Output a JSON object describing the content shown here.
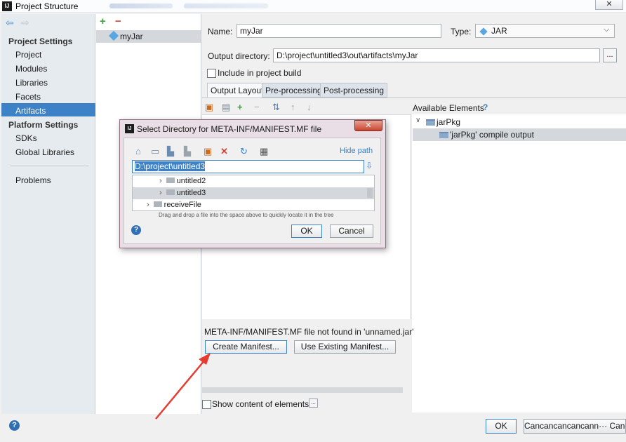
{
  "window": {
    "title": "Project Structure",
    "app_icon": "IJ",
    "close_glyph": "✕"
  },
  "sidebar": {
    "back_icon": "back-arrow-icon",
    "forward_icon": "forward-arrow-icon",
    "project_settings_heading": "Project Settings",
    "project_settings_items": [
      "Project",
      "Modules",
      "Libraries",
      "Facets",
      "Artifacts"
    ],
    "selected": "Artifacts",
    "platform_settings_heading": "Platform Settings",
    "platform_settings_items": [
      "SDKs",
      "Global Libraries"
    ],
    "problems": "Problems"
  },
  "artifacts_list": {
    "add_glyph": "+",
    "remove_glyph": "−",
    "items": [
      "myJar"
    ]
  },
  "artifact": {
    "name_label": "Name:",
    "name_value": "myJar",
    "type_label": "Type:",
    "type_value": "JAR",
    "output_dir_label": "Output directory:",
    "output_dir_value": "D:\\project\\untitled3\\out\\artifacts\\myJar",
    "browse_glyph": "...",
    "include_in_build_label": "Include in project build",
    "include_in_build_checked": false
  },
  "tabs": [
    "Output Layout",
    "Pre-processing",
    "Post-processing"
  ],
  "active_tab": "Output Layout",
  "available": {
    "label": "Available Elements",
    "help": "?",
    "tree": [
      {
        "label": "jarPkg",
        "expanded": true
      },
      {
        "label": "'jarPkg' compile output",
        "selected": true
      }
    ]
  },
  "manifest": {
    "message": "META-INF/MANIFEST.MF file not found in 'unnamed.jar'",
    "create_button": "Create Manifest...",
    "use_existing_button": "Use Existing Manifest...",
    "show_content_label": "Show content of elements",
    "show_content_button": "..."
  },
  "footer": {
    "help": "?",
    "ok": "OK",
    "cancel": "Cancancancancann··· Canc"
  },
  "dialog": {
    "title": "Select Directory for META-INF/MANIFEST.MF file",
    "close_glyph": "✕",
    "hide_path": "Hide path",
    "path_value": "D:\\project\\untitled3",
    "tree": [
      {
        "label": "untitled2",
        "level": 2
      },
      {
        "label": "untitled3",
        "level": 2,
        "selected": true
      },
      {
        "label": "receiveFile",
        "level": 1
      }
    ],
    "drag_hint": "Drag and drop a file into the space above to quickly locate it in the tree",
    "help": "?",
    "ok": "OK",
    "cancel": "Cancel"
  },
  "colors": {
    "selection": "#3d82c7",
    "arrow": "#e53b30"
  }
}
